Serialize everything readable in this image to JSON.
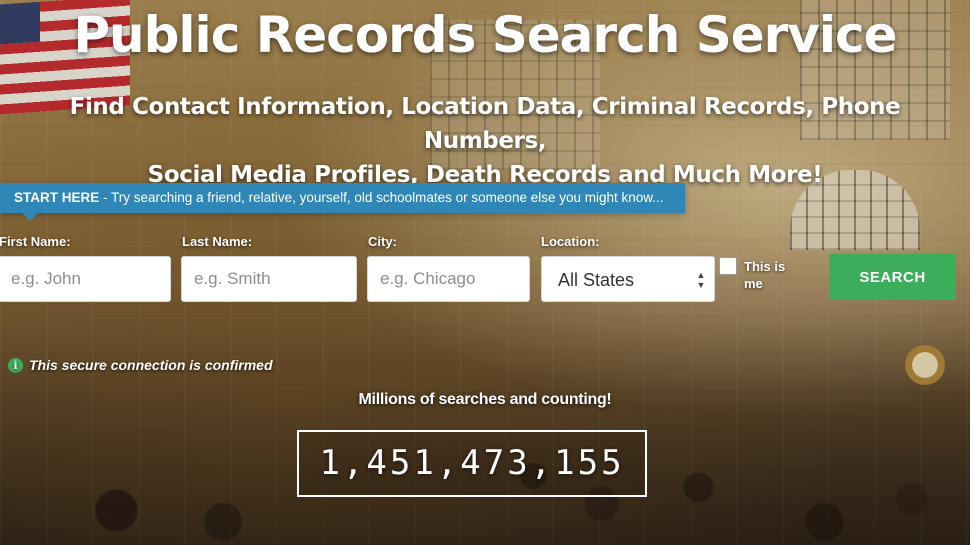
{
  "hero": {
    "title": "Public Records Search Service",
    "subtitle_line1": "Find Contact Information, Location Data, Criminal Records, Phone Numbers,",
    "subtitle_line2": "Social Media Profiles, Death Records and Much More!"
  },
  "banner": {
    "strong": "START HERE",
    "text": " - Try searching a friend, relative, yourself, old schoolmates or someone else you might know..."
  },
  "form": {
    "first_name": {
      "label": "First Name:",
      "placeholder": "e.g. John",
      "value": ""
    },
    "last_name": {
      "label": "Last Name:",
      "placeholder": "e.g. Smith",
      "value": ""
    },
    "city": {
      "label": "City:",
      "placeholder": "e.g. Chicago",
      "value": ""
    },
    "location": {
      "label": "Location:",
      "selected": "All States"
    },
    "this_is_me": {
      "label": "This is me",
      "checked": false
    },
    "search_label": "SEARCH"
  },
  "secure": {
    "icon": "info-icon",
    "text": "This secure connection is confirmed"
  },
  "counter": {
    "label": "Millions of searches and counting!",
    "value": "1,451,473,155"
  },
  "colors": {
    "banner": "#2f87b8",
    "search_button": "#3cae5b",
    "info_icon": "#3cae5b"
  }
}
